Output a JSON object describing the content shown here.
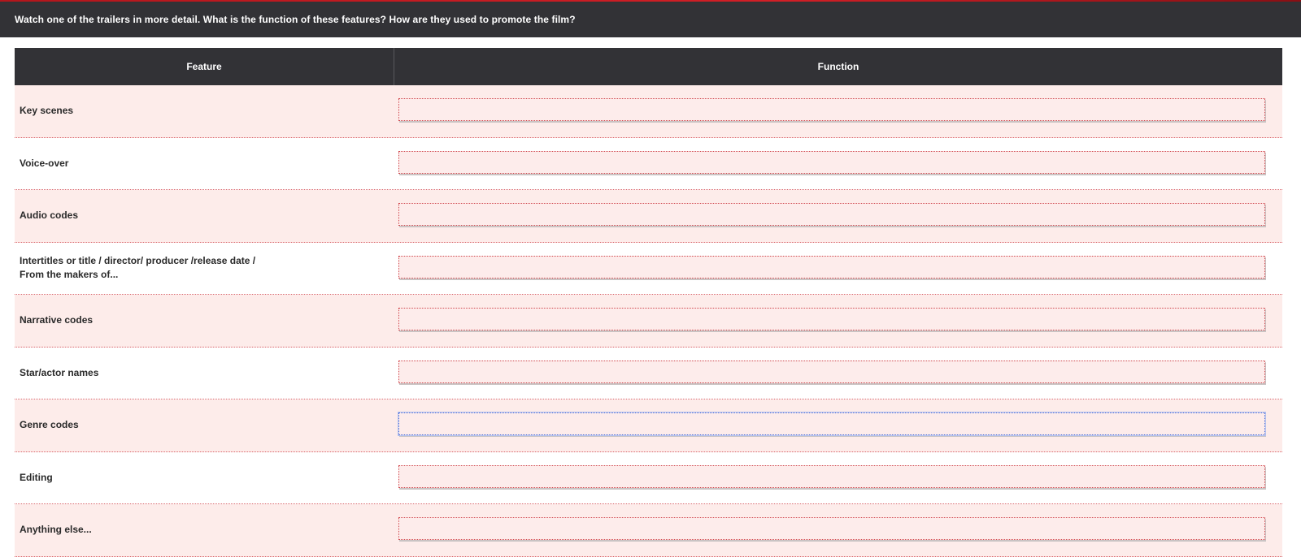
{
  "instruction": "Watch one of the trailers in more detail. What is the function of these features? How are they used to promote the film?",
  "table": {
    "headers": {
      "feature": "Feature",
      "function": "Function"
    },
    "rows": [
      {
        "feature": "Key scenes",
        "function_value": ""
      },
      {
        "feature": "Voice-over",
        "function_value": ""
      },
      {
        "feature": "Audio codes",
        "function_value": ""
      },
      {
        "feature": "Intertitles or title / director/ producer /release date /\nFrom the makers of...",
        "function_value": ""
      },
      {
        "feature": "Narrative codes",
        "function_value": ""
      },
      {
        "feature": "Star/actor names",
        "function_value": ""
      },
      {
        "feature": "Genre codes",
        "function_value": ""
      },
      {
        "feature": "Editing",
        "function_value": ""
      },
      {
        "feature": "Anything else...",
        "function_value": ""
      }
    ]
  },
  "colors": {
    "header_bg": "#323236",
    "row_pink": "#fdecea",
    "accent_red": "#d21f26",
    "focus_blue": "#4a6bd6"
  }
}
